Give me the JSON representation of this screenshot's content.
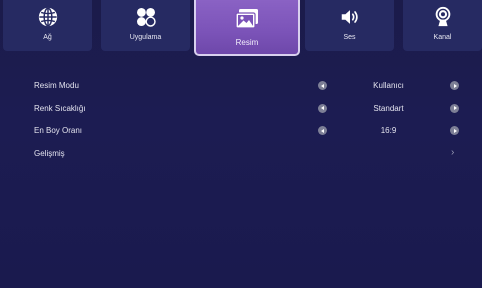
{
  "tabs": [
    {
      "label": "Ağ",
      "icon": "globe-icon"
    },
    {
      "label": "Uygulama",
      "icon": "apps-icon"
    },
    {
      "label": "Resim",
      "icon": "picture-icon",
      "active": true
    },
    {
      "label": "Ses",
      "icon": "speaker-icon"
    },
    {
      "label": "Kanal",
      "icon": "antenna-icon"
    }
  ],
  "menu": {
    "items": [
      {
        "label": "Resim Modu",
        "value": "Kullanıcı"
      },
      {
        "label": "Renk Sıcaklığı",
        "value": "Standart"
      },
      {
        "label": "En Boy Oranı",
        "value": "16:9"
      },
      {
        "label": "Gelişmiş",
        "chevron": "›"
      }
    ]
  },
  "colors": {
    "background": "#1b1b4a",
    "tab": "#262a62",
    "active_tab": "#7b53b8",
    "arrow_button": "#7d7f96"
  }
}
